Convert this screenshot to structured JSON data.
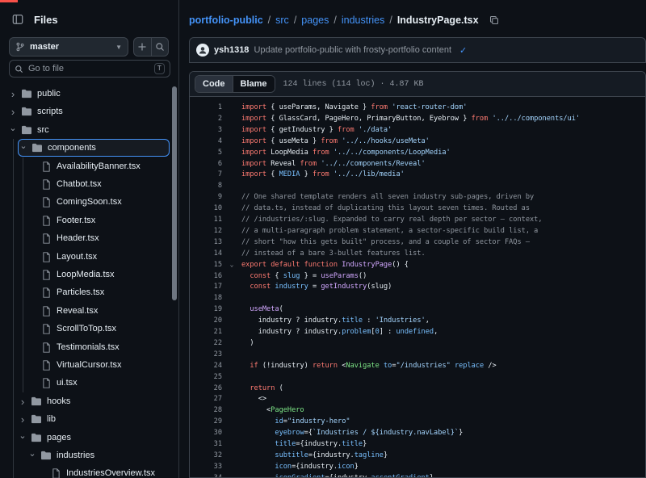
{
  "sidebar": {
    "title": "Files",
    "branch": "master",
    "goto_placeholder": "Go to file",
    "goto_shortcut": "T",
    "tree": [
      {
        "label": "public",
        "type": "folder",
        "depth": 0,
        "expanded": false
      },
      {
        "label": "scripts",
        "type": "folder",
        "depth": 0,
        "expanded": false
      },
      {
        "label": "src",
        "type": "folder",
        "depth": 0,
        "expanded": true
      },
      {
        "label": "components",
        "type": "folder",
        "depth": 1,
        "expanded": true,
        "selected": true
      },
      {
        "label": "AvailabilityBanner.tsx",
        "type": "file",
        "depth": 2
      },
      {
        "label": "Chatbot.tsx",
        "type": "file",
        "depth": 2
      },
      {
        "label": "ComingSoon.tsx",
        "type": "file",
        "depth": 2
      },
      {
        "label": "Footer.tsx",
        "type": "file",
        "depth": 2
      },
      {
        "label": "Header.tsx",
        "type": "file",
        "depth": 2
      },
      {
        "label": "Layout.tsx",
        "type": "file",
        "depth": 2
      },
      {
        "label": "LoopMedia.tsx",
        "type": "file",
        "depth": 2
      },
      {
        "label": "Particles.tsx",
        "type": "file",
        "depth": 2
      },
      {
        "label": "Reveal.tsx",
        "type": "file",
        "depth": 2
      },
      {
        "label": "ScrollToTop.tsx",
        "type": "file",
        "depth": 2
      },
      {
        "label": "Testimonials.tsx",
        "type": "file",
        "depth": 2
      },
      {
        "label": "VirtualCursor.tsx",
        "type": "file",
        "depth": 2
      },
      {
        "label": "ui.tsx",
        "type": "file",
        "depth": 2
      },
      {
        "label": "hooks",
        "type": "folder",
        "depth": 1,
        "expanded": false
      },
      {
        "label": "lib",
        "type": "folder",
        "depth": 1,
        "expanded": false
      },
      {
        "label": "pages",
        "type": "folder",
        "depth": 1,
        "expanded": true
      },
      {
        "label": "industries",
        "type": "folder",
        "depth": 2,
        "expanded": true
      },
      {
        "label": "IndustriesOverview.tsx",
        "type": "file",
        "depth": 3
      }
    ]
  },
  "breadcrumb": {
    "repo": "portfolio-public",
    "parts": [
      "src",
      "pages",
      "industries"
    ],
    "file": "IndustryPage.tsx"
  },
  "commit": {
    "author": "ysh1318",
    "message": "Update portfolio-public with frosty-portfolio content"
  },
  "file_header": {
    "tab_code": "Code",
    "tab_blame": "Blame",
    "meta": "124 lines (114 loc) · 4.87 KB"
  },
  "code": [
    {
      "n": "1",
      "t": [
        [
          "kw",
          "import"
        ],
        [
          "src",
          " { useParams, Navigate } "
        ],
        [
          "kw",
          "from"
        ],
        [
          "str",
          " 'react-router-dom'"
        ]
      ]
    },
    {
      "n": "2",
      "t": [
        [
          "kw",
          "import"
        ],
        [
          "src",
          " { GlassCard, PageHero, PrimaryButton, Eyebrow } "
        ],
        [
          "kw",
          "from"
        ],
        [
          "str",
          " '../../components/ui'"
        ]
      ]
    },
    {
      "n": "3",
      "t": [
        [
          "kw",
          "import"
        ],
        [
          "src",
          " { getIndustry } "
        ],
        [
          "kw",
          "from"
        ],
        [
          "str",
          " './data'"
        ]
      ]
    },
    {
      "n": "4",
      "t": [
        [
          "kw",
          "import"
        ],
        [
          "src",
          " { useMeta } "
        ],
        [
          "kw",
          "from"
        ],
        [
          "str",
          " '../../hooks/useMeta'"
        ]
      ]
    },
    {
      "n": "5",
      "t": [
        [
          "kw",
          "import"
        ],
        [
          "src",
          " LoopMedia "
        ],
        [
          "kw",
          "from"
        ],
        [
          "str",
          " '../../components/LoopMedia'"
        ]
      ]
    },
    {
      "n": "6",
      "t": [
        [
          "kw",
          "import"
        ],
        [
          "src",
          " Reveal "
        ],
        [
          "kw",
          "from"
        ],
        [
          "str",
          " '../../components/Reveal'"
        ]
      ]
    },
    {
      "n": "7",
      "t": [
        [
          "kw",
          "import"
        ],
        [
          "src",
          " { "
        ],
        [
          "cst",
          "MEDIA"
        ],
        [
          "src",
          " } "
        ],
        [
          "kw",
          "from"
        ],
        [
          "str",
          " '../../lib/media'"
        ]
      ]
    },
    {
      "n": "8",
      "t": []
    },
    {
      "n": "9",
      "t": [
        [
          "cm",
          "// One shared template renders all seven industry sub-pages, driven by"
        ]
      ]
    },
    {
      "n": "10",
      "t": [
        [
          "cm",
          "// data.ts, instead of duplicating this layout seven times. Routed as"
        ]
      ]
    },
    {
      "n": "11",
      "t": [
        [
          "cm",
          "// /industries/:slug. Expanded to carry real depth per sector — context,"
        ]
      ]
    },
    {
      "n": "12",
      "t": [
        [
          "cm",
          "// a multi-paragraph problem statement, a sector-specific build list, a"
        ]
      ]
    },
    {
      "n": "13",
      "t": [
        [
          "cm",
          "// short \"how this gets built\" process, and a couple of sector FAQs —"
        ]
      ]
    },
    {
      "n": "14",
      "t": [
        [
          "cm",
          "// instead of a bare 3-bullet features list."
        ]
      ]
    },
    {
      "n": "15",
      "fold": true,
      "t": [
        [
          "kw",
          "export default function"
        ],
        [
          "src",
          " "
        ],
        [
          "fn",
          "IndustryPage"
        ],
        [
          "src",
          "() {"
        ]
      ]
    },
    {
      "n": "16",
      "t": [
        [
          "src",
          "  "
        ],
        [
          "kw",
          "const"
        ],
        [
          "src",
          " { "
        ],
        [
          "cst",
          "slug"
        ],
        [
          "src",
          " } = "
        ],
        [
          "fn",
          "useParams"
        ],
        [
          "src",
          "()"
        ]
      ]
    },
    {
      "n": "17",
      "t": [
        [
          "src",
          "  "
        ],
        [
          "kw",
          "const"
        ],
        [
          "src",
          " "
        ],
        [
          "cst",
          "industry"
        ],
        [
          "src",
          " = "
        ],
        [
          "fn",
          "getIndustry"
        ],
        [
          "src",
          "(slug)"
        ]
      ]
    },
    {
      "n": "18",
      "t": []
    },
    {
      "n": "19",
      "t": [
        [
          "src",
          "  "
        ],
        [
          "fn",
          "useMeta"
        ],
        [
          "src",
          "("
        ]
      ]
    },
    {
      "n": "20",
      "t": [
        [
          "src",
          "    industry ? industry."
        ],
        [
          "cst",
          "title"
        ],
        [
          "src",
          " : "
        ],
        [
          "str",
          "'Industries'"
        ],
        [
          "src",
          ","
        ]
      ]
    },
    {
      "n": "21",
      "t": [
        [
          "src",
          "    industry ? industry."
        ],
        [
          "cst",
          "problem"
        ],
        [
          "src",
          "["
        ],
        [
          "cst",
          "0"
        ],
        [
          "src",
          "] : "
        ],
        [
          "cst",
          "undefined"
        ],
        [
          "src",
          ","
        ]
      ]
    },
    {
      "n": "22",
      "t": [
        [
          "src",
          "  )"
        ]
      ]
    },
    {
      "n": "23",
      "t": []
    },
    {
      "n": "24",
      "t": [
        [
          "src",
          "  "
        ],
        [
          "kw",
          "if"
        ],
        [
          "src",
          " (!industry) "
        ],
        [
          "kw",
          "return"
        ],
        [
          "src",
          " <"
        ],
        [
          "tag",
          "Navigate"
        ],
        [
          "src",
          " "
        ],
        [
          "cst",
          "to"
        ],
        [
          "src",
          "="
        ],
        [
          "str",
          "\"/industries\""
        ],
        [
          "src",
          " "
        ],
        [
          "cst",
          "replace"
        ],
        [
          "src",
          " />"
        ]
      ]
    },
    {
      "n": "25",
      "t": []
    },
    {
      "n": "26",
      "t": [
        [
          "src",
          "  "
        ],
        [
          "kw",
          "return"
        ],
        [
          "src",
          " ("
        ]
      ]
    },
    {
      "n": "27",
      "t": [
        [
          "src",
          "    <>"
        ]
      ]
    },
    {
      "n": "28",
      "t": [
        [
          "src",
          "      <"
        ],
        [
          "tag",
          "PageHero"
        ]
      ]
    },
    {
      "n": "29",
      "t": [
        [
          "src",
          "        "
        ],
        [
          "cst",
          "id"
        ],
        [
          "src",
          "="
        ],
        [
          "str",
          "\"industry-hero\""
        ]
      ]
    },
    {
      "n": "30",
      "t": [
        [
          "src",
          "        "
        ],
        [
          "cst",
          "eyebrow"
        ],
        [
          "src",
          "={"
        ],
        [
          "str",
          "`Industries / ${industry.navLabel}`"
        ],
        [
          "src",
          "}"
        ]
      ]
    },
    {
      "n": "31",
      "t": [
        [
          "src",
          "        "
        ],
        [
          "cst",
          "title"
        ],
        [
          "src",
          "={industry."
        ],
        [
          "cst",
          "title"
        ],
        [
          "src",
          "}"
        ]
      ]
    },
    {
      "n": "32",
      "t": [
        [
          "src",
          "        "
        ],
        [
          "cst",
          "subtitle"
        ],
        [
          "src",
          "={industry."
        ],
        [
          "cst",
          "tagline"
        ],
        [
          "src",
          "}"
        ]
      ]
    },
    {
      "n": "33",
      "t": [
        [
          "src",
          "        "
        ],
        [
          "cst",
          "icon"
        ],
        [
          "src",
          "={industry."
        ],
        [
          "cst",
          "icon"
        ],
        [
          "src",
          "}"
        ]
      ]
    },
    {
      "n": "34",
      "t": [
        [
          "src",
          "        "
        ],
        [
          "cst",
          "iconGradient"
        ],
        [
          "src",
          "={industry."
        ],
        [
          "cst",
          "accentGradient"
        ],
        [
          "src",
          "}"
        ]
      ]
    }
  ]
}
